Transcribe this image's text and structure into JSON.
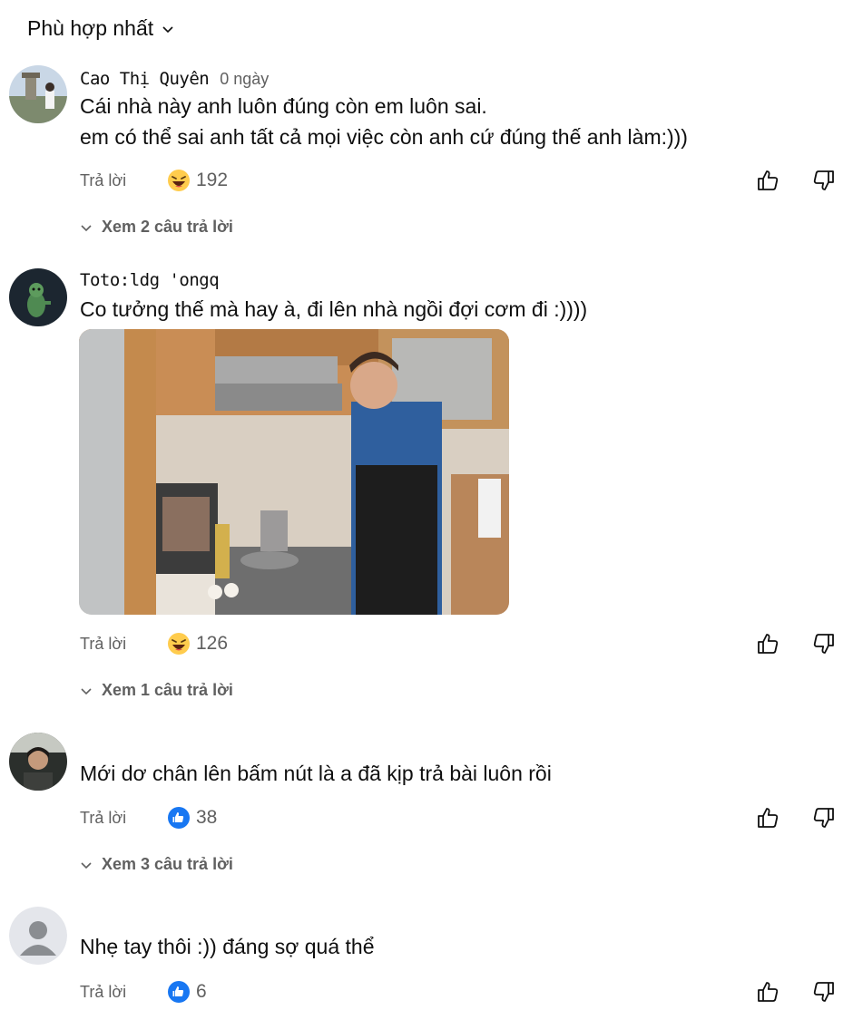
{
  "sort": {
    "label": "Phù hợp nhất"
  },
  "comments": [
    {
      "author": "Cao Thị Quyên",
      "time": "0 ngày",
      "lines": [
        "Cái nhà này anh luôn đúng còn em luôn sai.",
        "em có thể sai anh tất cả mọi việc còn anh cứ đúng thế anh làm:)))"
      ],
      "reply_label": "Trả lời",
      "reaction_icon": "laughing-emoji",
      "reaction_count": "192",
      "replies_label": "Xem 2 câu trả lời"
    },
    {
      "author": "Toto:ldg 'ongq",
      "time": "",
      "lines": [
        "Co tưởng thế mà hay à, đi lên nhà ngồi đợi cơm đi :))))"
      ],
      "reply_label": "Trả lời",
      "reaction_icon": "laughing-emoji",
      "reaction_count": "126",
      "replies_label": "Xem 1 câu trả lời"
    },
    {
      "author": "",
      "time": "",
      "lines": [
        "Mới dơ chân lên bấm nút là a đã kịp trả bài luôn rồi"
      ],
      "reply_label": "Trả lời",
      "reaction_icon": "blue-like",
      "reaction_count": "38",
      "replies_label": "Xem 3 câu trả lời"
    },
    {
      "author": "",
      "time": "",
      "lines": [
        "Nhẹ tay thôi :)) đáng sợ quá thể"
      ],
      "reply_label": "Trả lời",
      "reaction_icon": "blue-like",
      "reaction_count": "6",
      "replies_label": ""
    }
  ],
  "colors": {
    "text": "#0f0f0f",
    "secondary": "#606060",
    "like_blue": "#1877f2",
    "emoji_yellow": "#ffcc4d"
  }
}
